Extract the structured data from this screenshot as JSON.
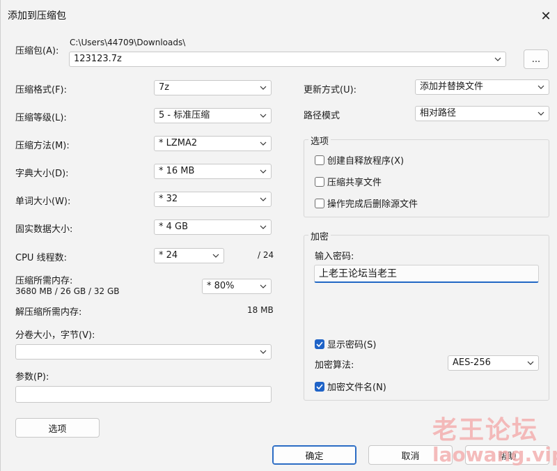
{
  "window": {
    "title": "添加到压缩包"
  },
  "archive": {
    "label": "压缩包(A):",
    "path": "C:\\Users\\44709\\Downloads\\",
    "filename": "123123.7z",
    "browse_label": "..."
  },
  "left": {
    "format_label": "压缩格式(F):",
    "format_value": "7z",
    "level_label": "压缩等级(L):",
    "level_value": "5 - 标准压缩",
    "method_label": "压缩方法(M):",
    "method_value": "* LZMA2",
    "dict_label": "字典大小(D):",
    "dict_value": "* 16 MB",
    "word_label": "单词大小(W):",
    "word_value": "* 32",
    "solid_label": "固实数据大小:",
    "solid_value": "* 4 GB",
    "threads_label": "CPU 线程数:",
    "threads_value": "* 24",
    "threads_total": "/ 24",
    "mem_label": "压缩所需内存:",
    "mem_detail": "3680 MB / 26 GB / 32 GB",
    "mem_value": "* 80%",
    "decomp_label": "解压缩所需内存:",
    "decomp_value": "18 MB",
    "split_label": "分卷大小，字节(V):",
    "split_value": "",
    "params_label": "参数(P):",
    "params_value": "",
    "options_button": "选项"
  },
  "right": {
    "update_label": "更新方式(U):",
    "update_value": "添加并替换文件",
    "path_label": "路径模式",
    "path_value": "相对路径",
    "options_group": "选项",
    "sfx_label": "创建自释放程序(X)",
    "sfx_checked": false,
    "shared_label": "压缩共享文件",
    "shared_checked": false,
    "delete_label": "操作完成后删除源文件",
    "delete_checked": false,
    "encrypt_group": "加密",
    "password_label": "输入密码:",
    "password_value": "上老王论坛当老王",
    "show_pw_label": "显示密码(S)",
    "show_pw_checked": true,
    "algo_label": "加密算法:",
    "algo_value": "AES-256",
    "encrypt_names_label": "加密文件名(N)",
    "encrypt_names_checked": true
  },
  "footer": {
    "ok": "确定",
    "cancel": "取消",
    "help": "帮助"
  },
  "watermark": {
    "line1": "老王论坛",
    "line2": "laowang.vip"
  },
  "colors": {
    "accent": "#1f63c7",
    "background": "#f3f3f3",
    "watermark": "#f3b0b0"
  }
}
